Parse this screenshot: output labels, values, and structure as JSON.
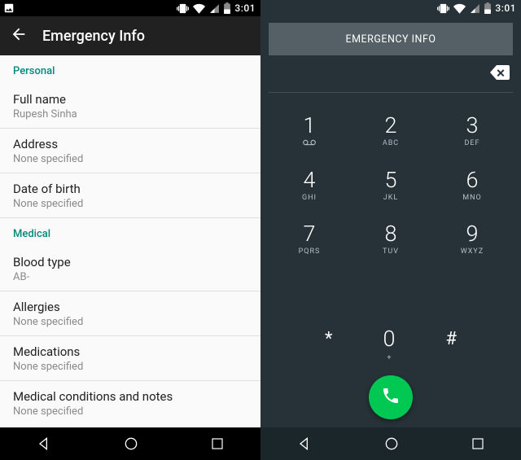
{
  "status": {
    "time": "3:01"
  },
  "info": {
    "title": "Emergency Info",
    "sections": [
      {
        "header": "Personal",
        "rows": [
          {
            "label": "Full name",
            "value": "Rupesh Sinha"
          },
          {
            "label": "Address",
            "value": "None specified"
          },
          {
            "label": "Date of birth",
            "value": "None specified"
          }
        ]
      },
      {
        "header": "Medical",
        "rows": [
          {
            "label": "Blood type",
            "value": "AB-"
          },
          {
            "label": "Allergies",
            "value": "None specified"
          },
          {
            "label": "Medications",
            "value": "None specified"
          },
          {
            "label": "Medical conditions and notes",
            "value": "None specified"
          }
        ]
      }
    ]
  },
  "dialer": {
    "button": "EMERGENCY INFO",
    "keys": [
      {
        "n": "1",
        "l": ""
      },
      {
        "n": "2",
        "l": "ABC"
      },
      {
        "n": "3",
        "l": "DEF"
      },
      {
        "n": "4",
        "l": "GHI"
      },
      {
        "n": "5",
        "l": "JKL"
      },
      {
        "n": "6",
        "l": "MNO"
      },
      {
        "n": "7",
        "l": "PQRS"
      },
      {
        "n": "8",
        "l": "TUV"
      },
      {
        "n": "9",
        "l": "WXYZ"
      }
    ],
    "star": "*",
    "zero": {
      "n": "0",
      "l": "+"
    },
    "hash": "#"
  }
}
